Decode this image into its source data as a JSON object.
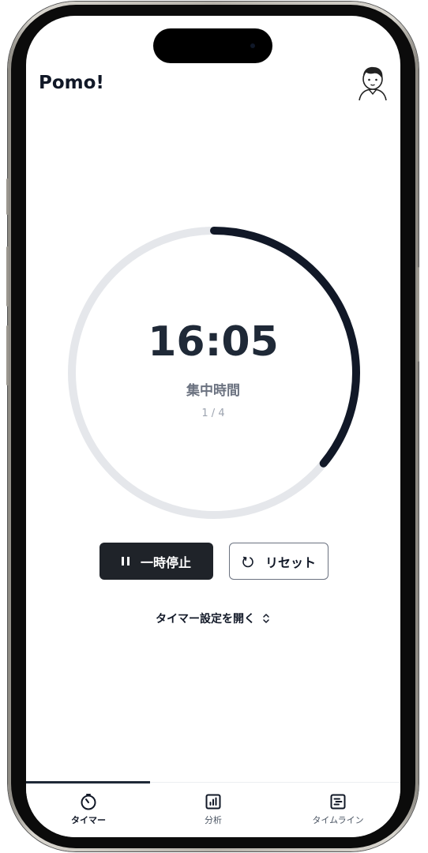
{
  "app": {
    "title": "Pomo!"
  },
  "header": {
    "avatar_icon": "user-avatar-icon"
  },
  "timer": {
    "time": "16:05",
    "phase": "集中時間",
    "cycle": "1 / 4",
    "progress_fraction": 0.36,
    "colors": {
      "track": "#e5e7eb",
      "progress": "#111827"
    }
  },
  "controls": {
    "pause_label": "一時停止",
    "pause_icon": "pause-icon",
    "reset_label": "リセット",
    "reset_icon": "reset-icon"
  },
  "settings": {
    "toggle_label": "タイマー設定を開く",
    "toggle_icon": "chevron-up-down-icon"
  },
  "tabs": [
    {
      "label": "タイマー",
      "icon": "timer-icon",
      "active": true
    },
    {
      "label": "分析",
      "icon": "analytics-icon",
      "active": false
    },
    {
      "label": "タイムライン",
      "icon": "timeline-icon",
      "active": false
    }
  ]
}
